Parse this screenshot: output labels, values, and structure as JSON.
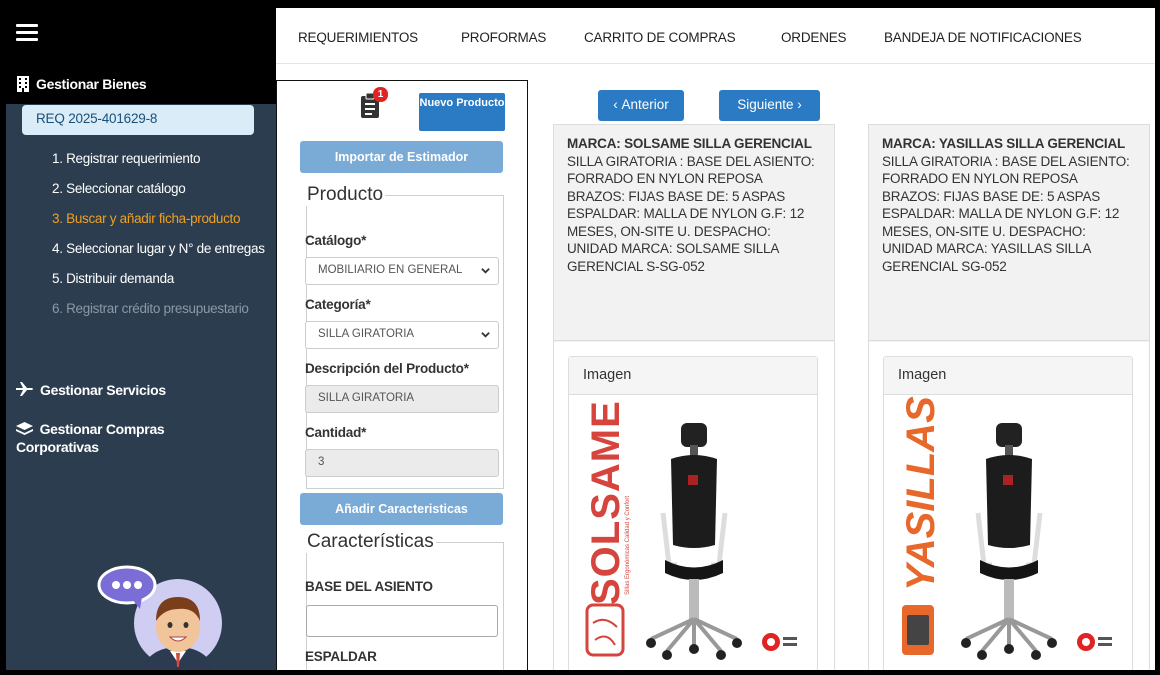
{
  "sidebar": {
    "gestionar_bienes": "Gestionar Bienes",
    "req_code": "REQ 2025-401629-8",
    "steps": [
      "1. Registrar requerimiento",
      "2. Seleccionar catálogo",
      "3. Buscar y añadir ficha-producto",
      "4. Seleccionar lugar y N° de entregas",
      "5. Distribuir demanda",
      "6. Registrar crédito presupuestario"
    ],
    "gestionar_servicios": "Gestionar Servicios",
    "gestionar_compras": "Gestionar Compras Corporativas"
  },
  "topnav": [
    "REQUERIMIENTOS",
    "PROFORMAS",
    "CARRITO DE COMPRAS",
    "ORDENES",
    "BANDEJA DE NOTIFICACIONES"
  ],
  "form": {
    "badge_count": "1",
    "nuevo_producto": "Nuevo Producto",
    "importar": "Importar de Estimador",
    "producto_legend": "Producto",
    "catalogo_label": "Catálogo*",
    "catalogo_value": "MOBILIARIO EN GENERAL",
    "categoria_label": "Categoría*",
    "categoria_value": "SILLA GIRATORIA",
    "descripcion_label": "Descripción del Producto*",
    "descripcion_value": "SILLA GIRATORIA",
    "cantidad_label": "Cantidad*",
    "cantidad_value": "3",
    "anadir": "Añadir Caracteristicas",
    "caracteristicas_legend": "Características",
    "base_label": "BASE DEL ASIENTO",
    "espaldar_label": "ESPALDAR"
  },
  "pager": {
    "prev": "Anterior",
    "next": "Siguiente"
  },
  "cards": [
    {
      "title": "MARCA: SOLSAME SILLA GERENCIAL",
      "desc": "SILLA GIRATORIA : BASE DEL ASIENTO: FORRADO EN NYLON REPOSA BRAZOS: FIJAS BASE DE: 5 ASPAS ESPALDAR: MALLA DE NYLON G.F: 12 MESES, ON-SITE U. DESPACHO: UNIDAD MARCA: SOLSAME SILLA GERENCIAL S-SG-052",
      "image_title": "Imagen",
      "brand_logo": "SOLSAME",
      "brand_tagline": "Sillas Ergonómicas Calidad y Confort"
    },
    {
      "title": "MARCA: YASILLAS SILLA GERENCIAL",
      "desc": "SILLA GIRATORIA : BASE DEL ASIENTO: FORRADO EN NYLON REPOSA BRAZOS: FIJAS BASE DE: 5 ASPAS ESPALDAR: MALLA DE NYLON G.F: 12 MESES, ON-SITE U. DESPACHO: UNIDAD MARCA: YASILLAS SILLA GERENCIAL SG-052",
      "image_title": "Imagen",
      "brand_logo": "YASILLAS"
    }
  ],
  "colors": {
    "primary": "#2b7bc4",
    "sidebar": "#2b3d4f",
    "active_step": "#f0a022"
  }
}
